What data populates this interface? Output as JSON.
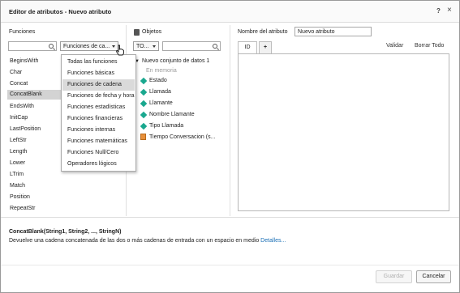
{
  "dialog": {
    "title": "Editor de atributos - Nuevo atributo",
    "help_label": "?",
    "close_label": "×"
  },
  "functions": {
    "heading": "Funciones",
    "search_value": "",
    "category_selected": "Funciones de ca...",
    "items": [
      "BeginsWith",
      "Char",
      "Concat",
      "ConcatBlank",
      "EndsWith",
      "InitCap",
      "LastPosition",
      "LeftStr",
      "Length",
      "Lower",
      "LTrim",
      "Match",
      "Position",
      "RepeatStr"
    ],
    "selected_index": 3
  },
  "category_menu": {
    "options": [
      "Todas las funciones",
      "Funciones básicas",
      "Funciones de cadena",
      "Funciones de fecha y hora",
      "Funciones estadísticas",
      "Funciones financieras",
      "Funciones internas",
      "Funciones matemáticas",
      "Funciones Null/Cero",
      "Operadores lógicos"
    ],
    "highlighted_index": 2
  },
  "objects": {
    "heading": "Objetos",
    "filter_selected": "TO...",
    "search_value": "",
    "dataset": "Nuevo conjunto de datos 1",
    "memory_label": "En memoria",
    "fields": [
      {
        "name": "Estado",
        "icon": "attribute-icon"
      },
      {
        "name": "Llamada",
        "icon": "attribute-icon"
      },
      {
        "name": "Llamante",
        "icon": "attribute-icon"
      },
      {
        "name": "Nombre Llamante",
        "icon": "attribute-form-icon"
      },
      {
        "name": "Tipo Llamada",
        "icon": "attribute-icon"
      },
      {
        "name": "Tiempo Conversacion (s...",
        "icon": "metric-icon"
      }
    ]
  },
  "attribute": {
    "name_label": "Nombre del atributo",
    "name_value": "Nuevo atributo",
    "tabs": [
      "ID",
      "+"
    ],
    "validate_label": "Validar",
    "clear_label": "Borrar Todo"
  },
  "help": {
    "signature": "ConcatBlank(String1, String2, ..., StringN)",
    "description": "Devuelve una cadena concatenada de las dos o más cadenas de entrada con un espacio en medio",
    "details_link": "Detalles..."
  },
  "footer": {
    "save_label": "Guardar",
    "cancel_label": "Cancelar"
  },
  "colors": {
    "attribute_icon": "#1aa88f",
    "metric_icon": "#e8903a",
    "link": "#1a6fb5",
    "selection": "#d3d3d3"
  }
}
